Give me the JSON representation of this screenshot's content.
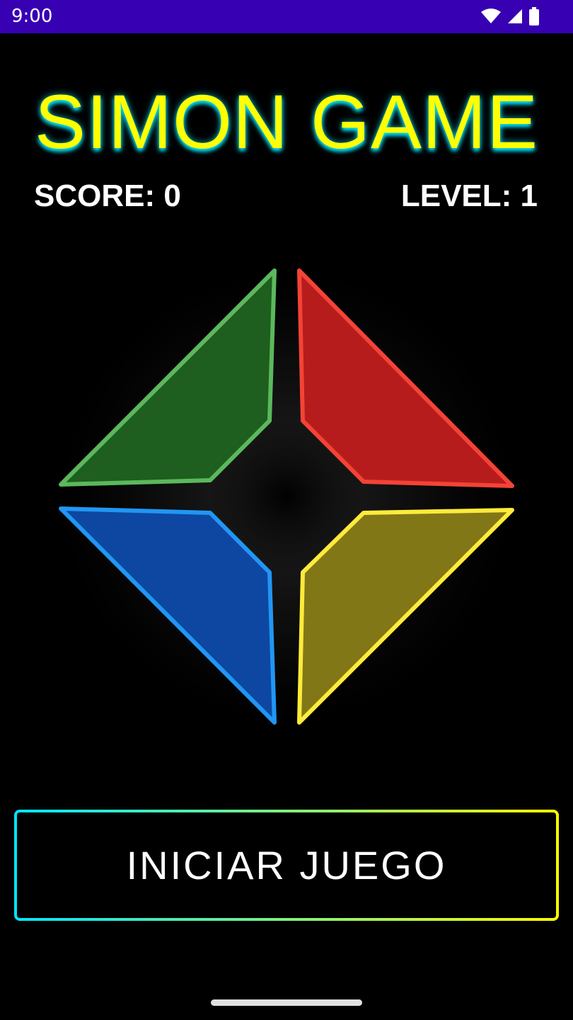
{
  "status_bar": {
    "time": "9:00",
    "icons": [
      "wifi-icon",
      "cellular-signal-icon",
      "battery-icon"
    ]
  },
  "app": {
    "title": "SIMON GAME",
    "score_label": "SCORE: 0",
    "level_label": "LEVEL: 1"
  },
  "board": {
    "pads": [
      {
        "name": "green",
        "fill": "#1e5e1e",
        "stroke": "#5cb85c"
      },
      {
        "name": "red",
        "fill": "#b71c1c",
        "stroke": "#f44336"
      },
      {
        "name": "blue",
        "fill": "#0d47a1",
        "stroke": "#2196f3"
      },
      {
        "name": "yellow",
        "fill": "#827717",
        "stroke": "#ffeb3b"
      }
    ]
  },
  "actions": {
    "start_label": "INICIAR JUEGO"
  },
  "colors": {
    "status_bar": "#3700b3",
    "title": "#ffff00",
    "title_shadow": "#00e5ff",
    "background": "#000000"
  }
}
